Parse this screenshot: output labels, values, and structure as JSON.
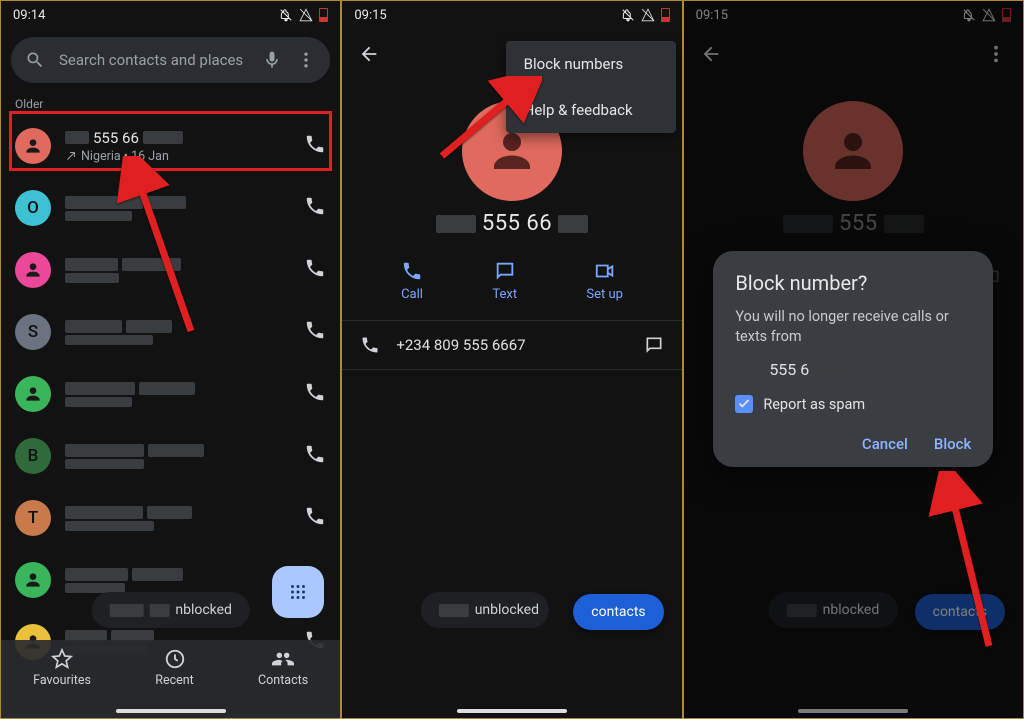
{
  "status": {
    "time1": "09:14",
    "time2": "09:15",
    "time3": "09:15"
  },
  "panel1": {
    "search_placeholder": "Search contacts and places",
    "section": "Older",
    "first_row": {
      "number_fragment": "555 66",
      "sub": "Nigeria • 16 Jan"
    },
    "rows": [
      {
        "letter": "O",
        "color": "#3ec1d3"
      },
      {
        "letter": "",
        "color": "#ec4899",
        "person": true
      },
      {
        "letter": "S",
        "color": "#6b7280"
      },
      {
        "letter": "",
        "color": "#3ab55c",
        "person": true
      },
      {
        "letter": "B",
        "color": "#2f6b3a"
      },
      {
        "letter": "T",
        "color": "#c97a4b"
      },
      {
        "letter": "",
        "color": "#3ab55c",
        "person": true
      },
      {
        "letter": "",
        "color": "#e8c03a",
        "person": true
      }
    ],
    "nav": {
      "fav": "Favourites",
      "recent": "Recent",
      "contacts": "Contacts"
    },
    "toast": "nblocked"
  },
  "panel2": {
    "menu": {
      "block": "Block numbers",
      "help": "Help & feedback"
    },
    "display_number": "555 66",
    "actions": {
      "call": "Call",
      "text": "Text",
      "setup": "Set up"
    },
    "detail_number": "+234 809 555 6667",
    "toast": "unblocked",
    "contacts_pill": "contacts"
  },
  "panel3": {
    "display_number": "555",
    "dialog": {
      "title": "Block number?",
      "body": "You will no longer receive calls or texts from",
      "number_fragment": "555 6",
      "spam": "Report as spam",
      "cancel": "Cancel",
      "block": "Block"
    },
    "toast": "nblocked",
    "contacts_pill": "contacts"
  }
}
